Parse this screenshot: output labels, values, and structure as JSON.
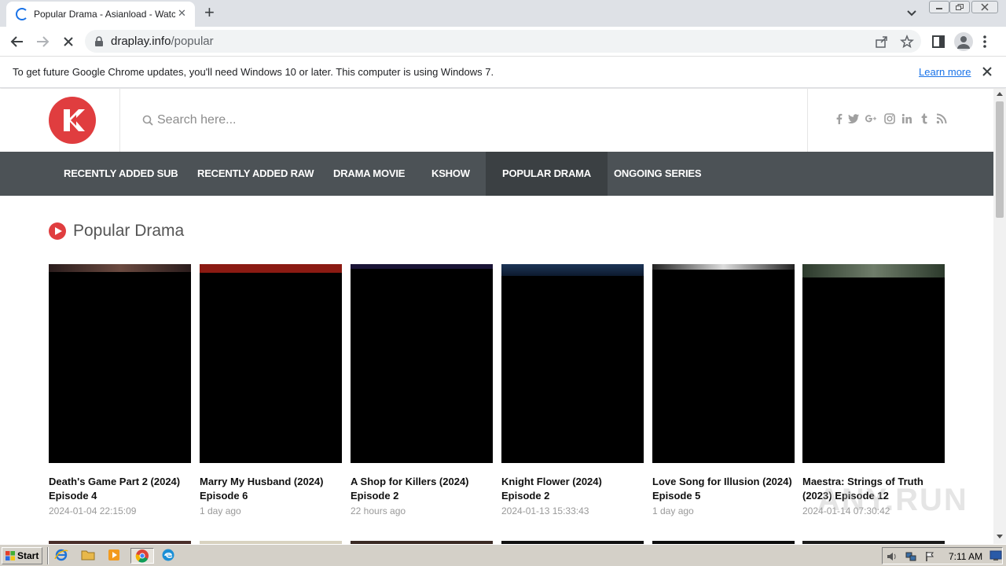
{
  "browser": {
    "tab_title": "Popular Drama - Asianload - Watch K",
    "tab_close": "✕",
    "new_tab": "+",
    "url_host": "draplay.info",
    "url_path": "/popular"
  },
  "infobar": {
    "message": "To get future Google Chrome updates, you'll need Windows 10 or later. This computer is using Windows 7.",
    "link": "Learn more"
  },
  "site": {
    "search_placeholder": "Search here...",
    "socials": [
      "facebook-icon",
      "twitter-icon",
      "google-plus-icon",
      "instagram-icon",
      "linkedin-icon",
      "tumblr-icon",
      "rss-icon"
    ],
    "nav": [
      {
        "label": "RECENTLY ADDED SUB",
        "active": false
      },
      {
        "label": "RECENTLY ADDED RAW",
        "active": false
      },
      {
        "label": "DRAMA MOVIE",
        "active": false
      },
      {
        "label": "KSHOW",
        "active": false
      },
      {
        "label": "POPULAR DRAMA",
        "active": true
      },
      {
        "label": "ONGOING SERIES",
        "active": false
      }
    ],
    "section_title": "Popular Drama",
    "cards": [
      {
        "title": "Death's Game Part 2 (2024) Episode 4",
        "time": "2024-01-04 22:15:09"
      },
      {
        "title": "Marry My Husband (2024) Episode 6",
        "time": "1 day ago"
      },
      {
        "title": "A Shop for Killers (2024) Episode 2",
        "time": "22 hours ago"
      },
      {
        "title": "Knight Flower (2024) Episode 2",
        "time": "2024-01-13 15:33:43"
      },
      {
        "title": "Love Song for Illusion (2024) Episode 5",
        "time": "1 day ago"
      },
      {
        "title": "Maestra: Strings of Truth (2023) Episode 12",
        "time": "2024-01-14 07:30:42"
      }
    ],
    "accent_color": "#e03d3f",
    "nav_color": "#4c5256"
  },
  "watermark": "ANY.RUN",
  "taskbar": {
    "start_label": "Start",
    "clock": "7:11 AM"
  }
}
